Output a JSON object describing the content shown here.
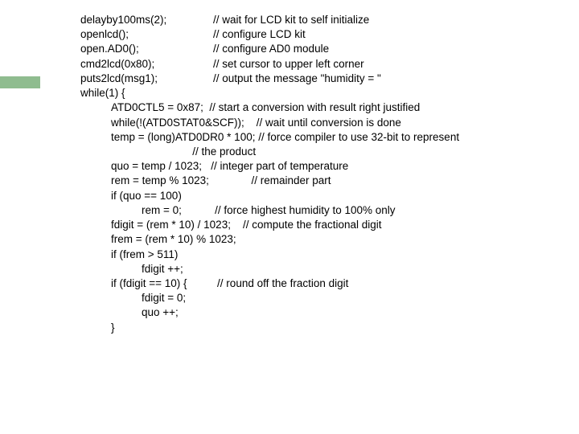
{
  "code": {
    "l1a": "delayby100ms(2);",
    "l1b": "// wait for LCD kit to self initialize",
    "l2a": "openlcd();",
    "l2b": "// configure LCD kit",
    "l3a": "open.AD0();",
    "l3b": "// configure AD0 module",
    "l4a": "cmd2lcd(0x80);",
    "l4b": "// set cursor to upper left corner",
    "l5a": "puts2lcd(msg1);",
    "l5b": "// output the message \"humidity = \"",
    "l6": "while(1) {",
    "l7": "ATD0CTL5 = 0x87;  // start a conversion with result right justified",
    "l8": "while(!(ATD0STAT0&SCF));    // wait until conversion is done",
    "l9": "temp = (long)ATD0DR0 * 100; // force compiler to use 32-bit to represent",
    "l10": "                           // the product",
    "l11": "quo = temp / 1023;   // integer part of temperature",
    "l12": "rem = temp % 1023;              // remainder part",
    "l13": "if (quo == 100)",
    "l14": "rem = 0;           // force highest humidity to 100% only",
    "l15": "fdigit = (rem * 10) / 1023;    // compute the fractional digit",
    "l16": "frem = (rem * 10) % 1023;",
    "l17": "if (frem > 511)",
    "l18": "fdigit ++;",
    "l19": "if (fdigit == 10) {          // round off the fraction digit",
    "l20": "fdigit = 0;",
    "l21": "quo ++;",
    "l22": "}"
  }
}
